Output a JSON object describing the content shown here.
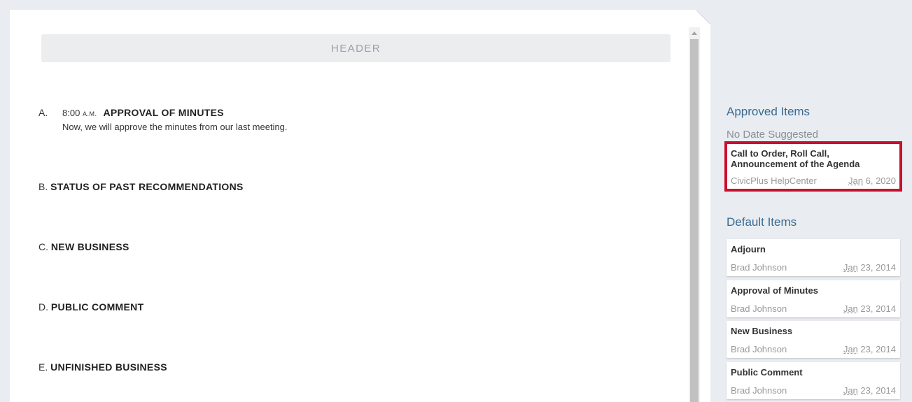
{
  "document": {
    "header_label": "HEADER",
    "items": [
      {
        "letter": "A.",
        "time": "8:00",
        "time_suffix": "A.M.",
        "title": "APPROVAL OF MINUTES",
        "description": "Now, we will approve the minutes from our last meeting."
      },
      {
        "letter": "B.",
        "title": "STATUS OF PAST RECOMMENDATIONS"
      },
      {
        "letter": "C.",
        "title": "NEW BUSINESS"
      },
      {
        "letter": "D.",
        "title": "PUBLIC COMMENT"
      },
      {
        "letter": "E.",
        "title": "UNFINISHED BUSINESS"
      }
    ]
  },
  "sidebar": {
    "approved": {
      "title": "Approved Items",
      "subhead": "No Date Suggested",
      "items": [
        {
          "title": "Call to Order, Roll Call, Announcement of the Agenda",
          "author": "CivicPlus HelpCenter",
          "date_month": "Jan",
          "date_rest": " 6, 2020",
          "highlight_color": "#c8102e"
        }
      ]
    },
    "defaults": {
      "title": "Default Items",
      "items": [
        {
          "title": "Adjourn",
          "author": "Brad Johnson",
          "date_month": "Jan",
          "date_rest": " 23, 2014"
        },
        {
          "title": "Approval of Minutes",
          "author": "Brad Johnson",
          "date_month": "Jan",
          "date_rest": " 23, 2014"
        },
        {
          "title": "New Business",
          "author": "Brad Johnson",
          "date_month": "Jan",
          "date_rest": " 23, 2014"
        },
        {
          "title": "Public Comment",
          "author": "Brad Johnson",
          "date_month": "Jan",
          "date_rest": " 23, 2014"
        }
      ]
    }
  },
  "colors": {
    "accent": "#3a6a92",
    "highlight": "#c8102e",
    "background": "#e9edf1"
  }
}
